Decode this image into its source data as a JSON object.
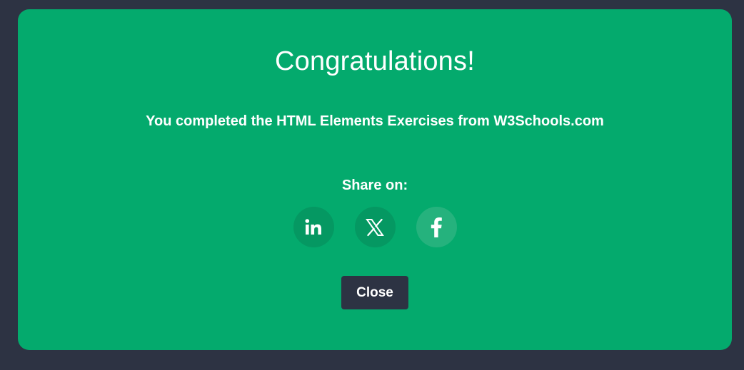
{
  "modal": {
    "title": "Congratulations!",
    "message": "You completed the HTML Elements Exercises from W3Schools.com",
    "share_label": "Share on:",
    "share_buttons": [
      {
        "icon": "linkedin-icon",
        "label": "LinkedIn"
      },
      {
        "icon": "x-icon",
        "label": "X"
      },
      {
        "icon": "facebook-icon",
        "label": "Facebook"
      }
    ],
    "close_label": "Close"
  },
  "colors": {
    "backdrop": "#2d3343",
    "modal_background": "#04aa6d",
    "share_button_dark": "#059862",
    "share_button_light": "#25b27d",
    "close_button": "#2d3343",
    "text": "#ffffff"
  }
}
